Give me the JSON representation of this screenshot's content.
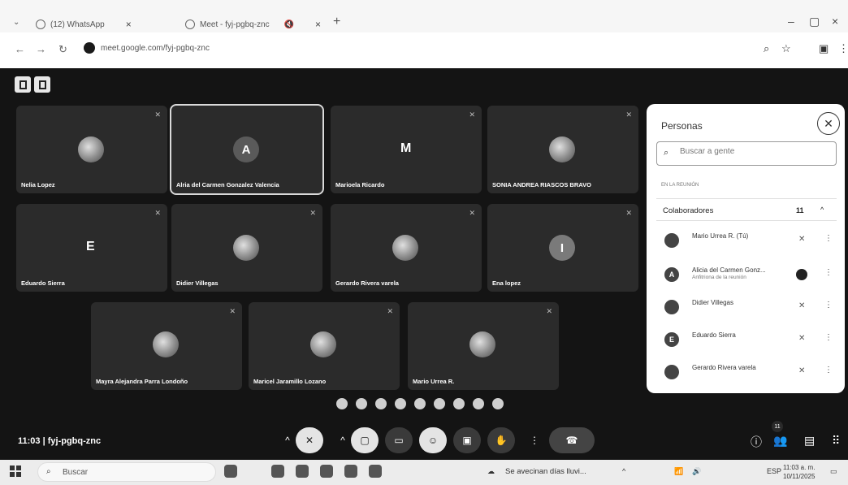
{
  "browser": {
    "tabs": [
      {
        "label": "(12) WhatsApp",
        "close": "×"
      },
      {
        "label": "Meet - fyj-pgbq-znc",
        "close": "×"
      }
    ],
    "new_tab": "+",
    "url": "meet.google.com/fyj-pgbq-znc",
    "window_controls": {
      "minimize": "–",
      "maximize": "▢",
      "close": "×"
    }
  },
  "meet": {
    "tiles": [
      {
        "name": "Nelia Lopez",
        "avatar_type": "photo"
      },
      {
        "name": "Alria del Carmen Gonzalez Valencia",
        "avatar_type": "letter",
        "letter": "A",
        "active": true
      },
      {
        "name": "Marioela Ricardo",
        "avatar_type": "plain",
        "letter": "M"
      },
      {
        "name": "SONIA ANDREA RIASCOS BRAVO",
        "avatar_type": "photo"
      },
      {
        "name": "Eduardo Sierra",
        "avatar_type": "plain",
        "letter": "E"
      },
      {
        "name": "Didier Villegas",
        "avatar_type": "photo"
      },
      {
        "name": "Gerardo Rivera varela",
        "avatar_type": "photo"
      },
      {
        "name": "Ena lopez",
        "avatar_type": "letter",
        "letter": "I"
      },
      {
        "name": "Mayra Alejandra Parra Londoño",
        "avatar_type": "photo"
      },
      {
        "name": "Maricel Jaramillo Lozano",
        "avatar_type": "photo"
      },
      {
        "name": "Mario Urrea R.",
        "avatar_type": "photo"
      }
    ],
    "meeting_time": "11:03",
    "meeting_code": "fyj-pgbq-znc",
    "participant_count": "11"
  },
  "people_panel": {
    "title": "Personas",
    "search_placeholder": "Buscar a gente",
    "section_label": "EN LA REUNIÓN",
    "group_label": "Colaboradores",
    "group_count": "11",
    "people": [
      {
        "name": "Mario Urrea R. (Tú)",
        "sub": "",
        "avatar": "photo",
        "mic": "muted"
      },
      {
        "name": "Alicia del Carmen Gonz...",
        "sub": "Anfitriona de la reunión",
        "avatar": "A",
        "mic": "speaking"
      },
      {
        "name": "Didier Villegas",
        "sub": "",
        "avatar": "photo",
        "mic": "muted"
      },
      {
        "name": "Eduardo Sierra",
        "sub": "",
        "avatar": "E",
        "mic": "muted"
      },
      {
        "name": "Gerardo Rivera varela",
        "sub": "",
        "avatar": "photo",
        "mic": "muted"
      }
    ]
  },
  "taskbar": {
    "search_label": "Buscar",
    "weather_text": "Se avecinan días lluvi...",
    "language": "ESP",
    "clock_time": "11:03 a. m.",
    "clock_date": "10/11/2025"
  },
  "colors": {
    "meet_bg": "#141414",
    "tile_bg": "#2b2b2b",
    "panel_bg": "#ffffff"
  }
}
